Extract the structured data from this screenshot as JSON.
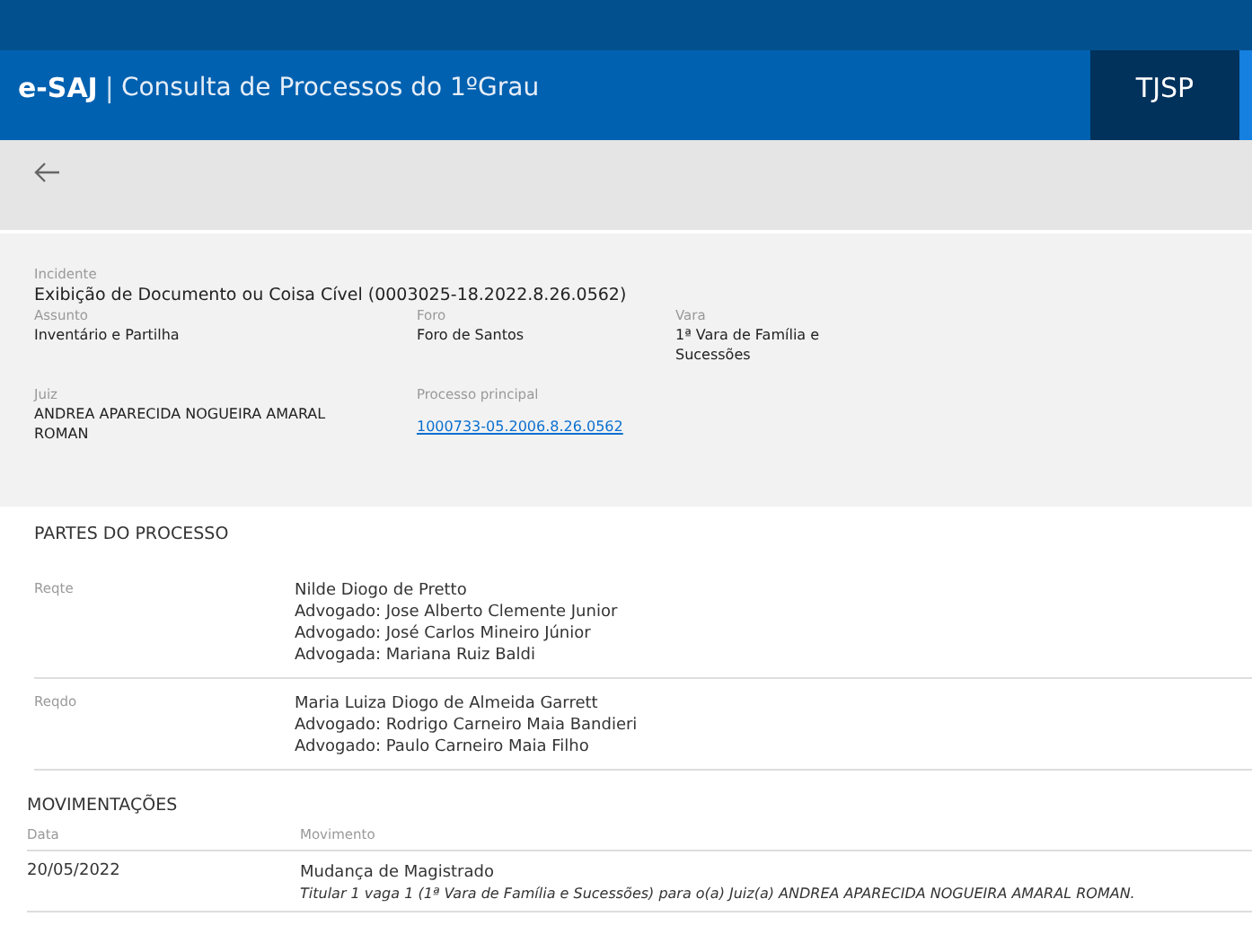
{
  "header": {
    "brand": "e-SAJ",
    "separator": "|",
    "title": "Consulta de Processos do 1ºGrau",
    "court": "TJSP"
  },
  "incidente": {
    "label": "Incidente",
    "value": "Exibição de Documento ou Coisa Cível (0003025-18.2022.8.26.0562)"
  },
  "fields": [
    {
      "label": "Assunto",
      "value": "Inventário e Partilha"
    },
    {
      "label": "Foro",
      "value": "Foro de Santos"
    },
    {
      "label": "Vara",
      "value": "1ª Vara de Família e Sucessões"
    },
    {
      "label": "Juiz",
      "value": "ANDREA APARECIDA NOGUEIRA AMARAL ROMAN"
    },
    {
      "label": "Processo principal",
      "value": "1000733-05.2006.8.26.0562",
      "kind": "link"
    }
  ],
  "partes": {
    "title": "PARTES DO PROCESSO",
    "rows": [
      {
        "role": "Reqte",
        "lines": [
          "Nilde Diogo de Pretto",
          "Advogado:  Jose Alberto Clemente Junior",
          "Advogado:  José Carlos Mineiro Júnior",
          "Advogada:  Mariana Ruiz Baldi"
        ]
      },
      {
        "role": "Reqdo",
        "lines": [
          "Maria Luiza Diogo de Almeida Garrett",
          "Advogado:  Rodrigo Carneiro Maia Bandieri",
          "Advogado:  Paulo Carneiro Maia Filho"
        ]
      }
    ]
  },
  "movimentacoes": {
    "title": "MOVIMENTAÇÕES",
    "columns": [
      "Data",
      "Movimento"
    ],
    "rows": [
      {
        "date": "20/05/2022",
        "title": "Mudança de Magistrado",
        "detail": "Titular 1 vaga 1 (1ª Vara de Família e Sucessões) para o(a) Juiz(a) ANDREA APARECIDA NOGUEIRA AMARAL ROMAN."
      }
    ]
  }
}
